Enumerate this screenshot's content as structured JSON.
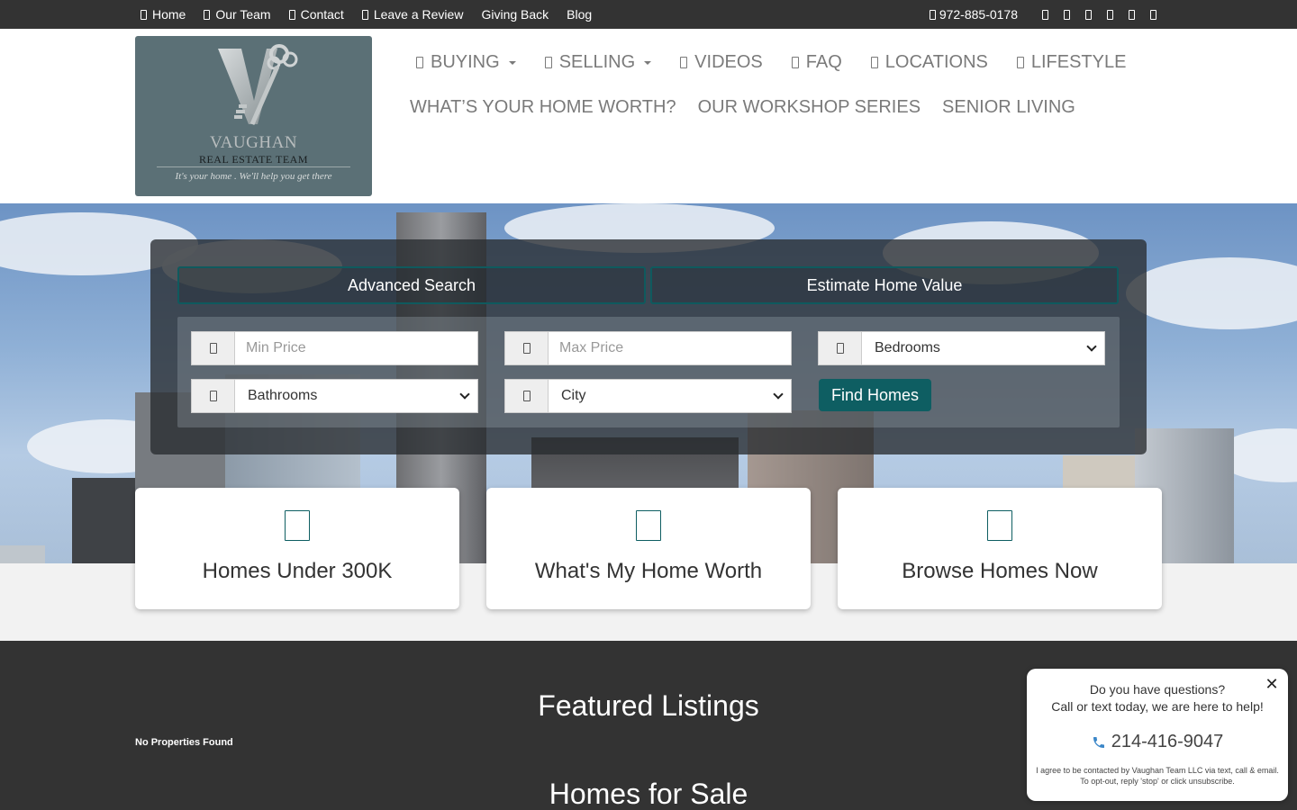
{
  "topbar": {
    "links": [
      "Home",
      "Our Team",
      "Contact",
      "Leave a Review",
      "Giving Back",
      "Blog"
    ],
    "phone": "972-885-0178",
    "social_icons": [
      "facebook-icon",
      "twitter-icon",
      "linkedin-icon",
      "instagram-icon",
      "youtube-icon",
      "email-icon"
    ]
  },
  "logo": {
    "brand_line1": "VAUGHAN",
    "brand_line2": "REAL ESTATE TEAM",
    "tagline": "It's your home . We'll help you get  there"
  },
  "nav": {
    "row1": [
      {
        "label": "BUYING",
        "dropdown": true
      },
      {
        "label": "SELLING",
        "dropdown": true
      },
      {
        "label": "VIDEOS",
        "dropdown": false
      },
      {
        "label": "FAQ",
        "dropdown": false
      },
      {
        "label": "LOCATIONS",
        "dropdown": false
      },
      {
        "label": "LIFESTYLE",
        "dropdown": false
      }
    ],
    "row2": [
      "WHAT’S YOUR HOME WORTH?",
      "OUR WORKSHOP SERIES",
      "SENIOR LIVING"
    ]
  },
  "search": {
    "tab_advanced": "Advanced Search",
    "tab_estimate": "Estimate Home Value",
    "min_price_placeholder": "Min Price",
    "max_price_placeholder": "Max Price",
    "bedrooms_value": "Bedrooms",
    "bathrooms_value": "Bathrooms",
    "city_value": "City",
    "find_button": "Find Homes"
  },
  "cards": [
    "Homes Under 300K",
    "What's My Home Worth",
    "Browse Homes Now"
  ],
  "featured": {
    "title": "Featured Listings",
    "empty_text": "No Properties Found",
    "homes_for_sale": "Homes for Sale"
  },
  "chat": {
    "close": "✕",
    "line1": "Do you have questions?",
    "line2": "Call or text today, we are here to help!",
    "phone": "214-416-9047",
    "disclaimer": "I agree to be contacted by Vaughan Team LLC via text, call & email. To opt-out, reply 'stop' or click unsubscribe."
  },
  "colors": {
    "accent": "#0e5e62",
    "topbar_bg": "#333333",
    "logo_bg": "#5b7076",
    "nav_text": "#7a7a7a"
  }
}
